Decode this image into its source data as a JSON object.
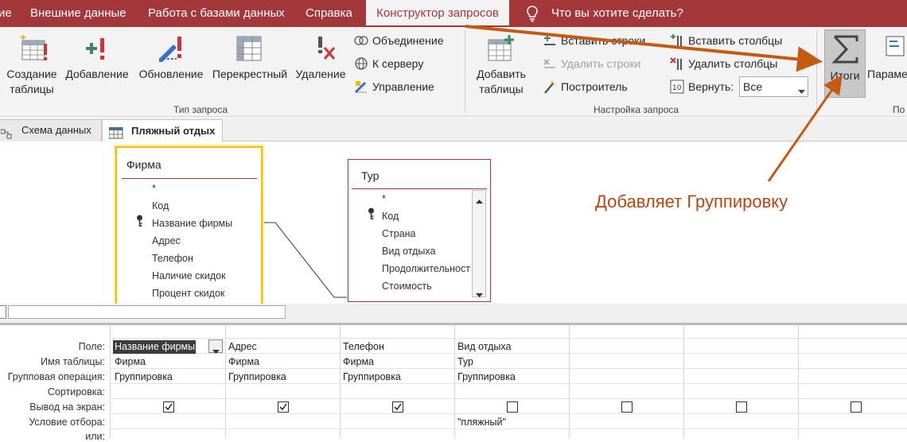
{
  "menu": {
    "tabs": [
      "ие",
      "Внешние данные",
      "Работа с базами данных",
      "Справка",
      "Конструктор запросов",
      "Что вы хотите сделать?"
    ]
  },
  "ribbon": {
    "query_type": {
      "buttons": [
        "Создание таблицы",
        "Добавление",
        "Обновление",
        "Перекрестный",
        "Удаление"
      ],
      "small": [
        "Объединение",
        "К серверу",
        "Управление"
      ],
      "label": "Тип запроса"
    },
    "setup": {
      "add_tables": "Добавить таблицы",
      "small": [
        "Вставить строки",
        "Удалить строки",
        "Построитель",
        "Вставить столбцы",
        "Удалить столбцы",
        "Вернуть:"
      ],
      "return_value": "Все",
      "label": "Настройка запроса"
    },
    "totals": "Итоги",
    "params": "Парамет",
    "cut_label": "По"
  },
  "doc_tabs": [
    "Схема данных",
    "Пляжный отдых"
  ],
  "tables": [
    {
      "name": "Фирма",
      "fields": [
        "*",
        "Код",
        "Название фирмы",
        "Адрес",
        "Телефон",
        "Наличие скидок",
        "Процент скидок"
      ]
    },
    {
      "name": "Тур",
      "fields": [
        "*",
        "Код",
        "Страна",
        "Вид отдыха",
        "Продолжительность",
        "Стоимость"
      ]
    }
  ],
  "annotation": "Добавляет Группировку",
  "grid": {
    "row_labels": [
      "Поле:",
      "Имя таблицы:",
      "Групповая операция:",
      "Сортировка:",
      "Вывод на экран:",
      "Условие отбора:",
      "или:"
    ],
    "columns": [
      {
        "field": "Название фирмы",
        "table": "Фирма",
        "op": "Группировка",
        "show": true,
        "criteria": ""
      },
      {
        "field": "Адрес",
        "table": "Фирма",
        "op": "Группировка",
        "show": true,
        "criteria": ""
      },
      {
        "field": "Телефон",
        "table": "Фирма",
        "op": "Группировка",
        "show": true,
        "criteria": ""
      },
      {
        "field": "Вид отдыха",
        "table": "Тур",
        "op": "Группировка",
        "show": false,
        "criteria": "\"пляжный\""
      },
      {
        "field": "",
        "table": "",
        "op": "",
        "show": false,
        "criteria": ""
      },
      {
        "field": "",
        "table": "",
        "op": "",
        "show": false,
        "criteria": ""
      },
      {
        "field": "",
        "table": "",
        "op": "",
        "show": false,
        "criteria": ""
      }
    ]
  }
}
